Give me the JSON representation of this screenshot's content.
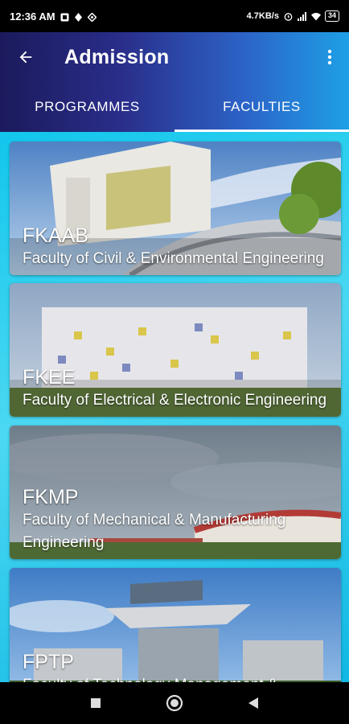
{
  "status_bar": {
    "time": "12:36 AM",
    "network_speed": "4.7KB/s",
    "battery": "34",
    "icons": [
      "gallery-icon",
      "location-icon",
      "app-icon",
      "alarm-icon",
      "signal-icon",
      "wifi-icon",
      "battery-icon"
    ]
  },
  "header": {
    "title": "Admission",
    "back_icon": "arrow-back-icon",
    "menu_icon": "more-vert-icon"
  },
  "tabs": [
    {
      "label": "PROGRAMMES",
      "selected": false
    },
    {
      "label": "FACULTIES",
      "selected": true
    }
  ],
  "faculties": [
    {
      "abbr": "FKAAB",
      "name": "Faculty of Civil & Environmental Engineering"
    },
    {
      "abbr": "FKEE",
      "name": "Faculty of Electrical & Electronic Engineering"
    },
    {
      "abbr": "FKMP",
      "name": "Faculty of Mechanical & Manufacturing Engineering"
    },
    {
      "abbr": "FPTP",
      "name": "Faculty of Technology Management &"
    }
  ],
  "nav_bar": {
    "icons": [
      "recents-square-icon",
      "home-circle-icon",
      "back-triangle-icon"
    ]
  },
  "colors": {
    "appbar_start": "#1b1a5c",
    "appbar_end": "#1ea0e6",
    "content_bg": "#12c6ec"
  }
}
